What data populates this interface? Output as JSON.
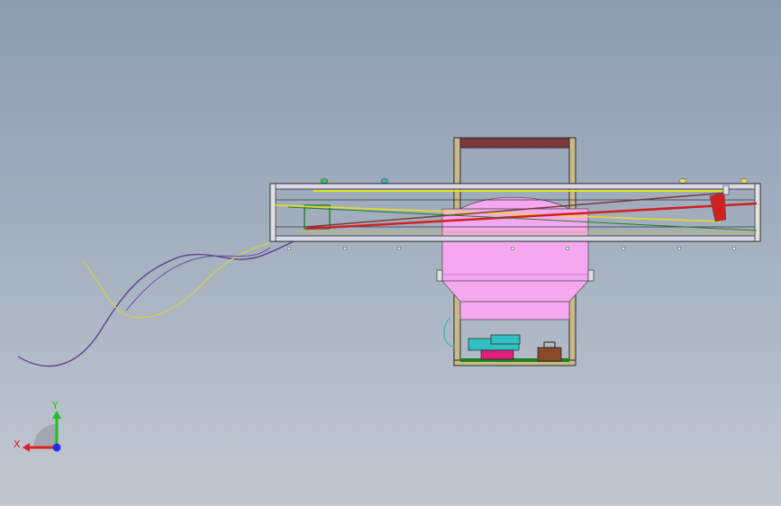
{
  "viewport": {
    "background_top": "#8d9cb0",
    "background_bottom": "#c2c8d1"
  },
  "triad": {
    "x_label": "X",
    "y_label": "Y",
    "x_color": "#e02020",
    "y_color": "#20c020",
    "z_color": "#2030e0"
  },
  "colors": {
    "frame_outline": "#2a2a2a",
    "tan_frame": "#c8b98a",
    "top_bar": "#7a3a3a",
    "pink_tank": "#f5a8f0",
    "yellow_line": "#e8e020",
    "red_line": "#d02020",
    "green_line": "#208020",
    "purple_cable": "#5a3a8a",
    "cyan_part": "#30c0c0",
    "magenta_part": "#e0207a",
    "brown_part": "#8a4a2a"
  }
}
